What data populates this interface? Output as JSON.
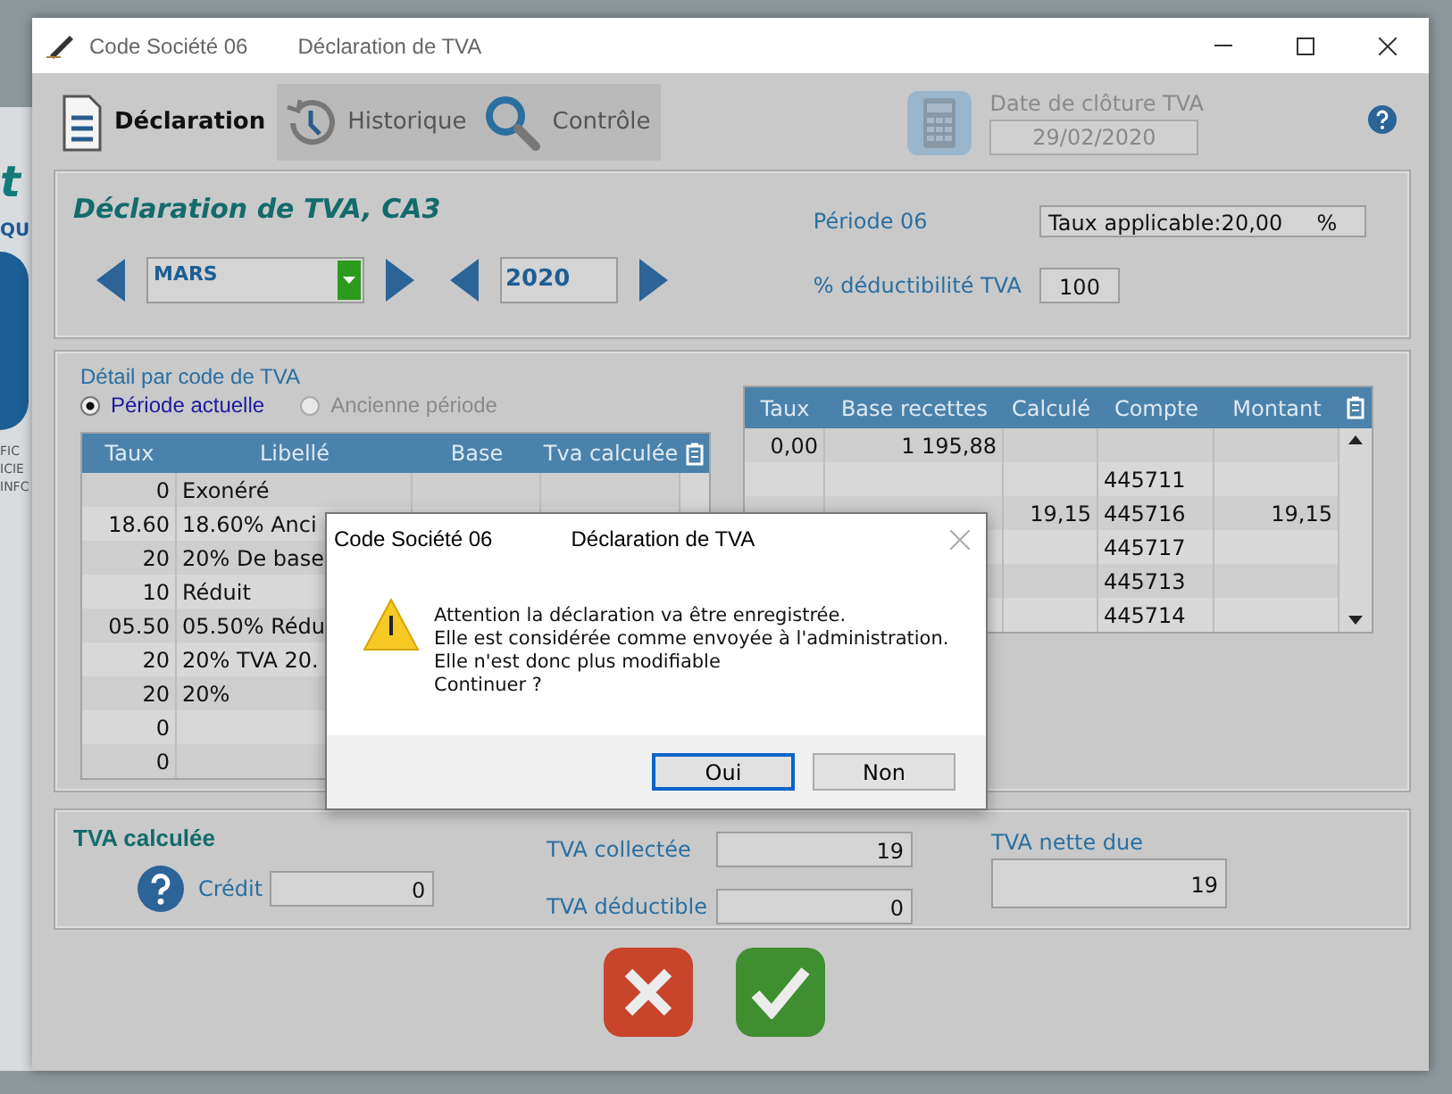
{
  "background": {
    "fragments": [
      {
        "text": "t",
        "kind": "heading"
      },
      {
        "text": "QU",
        "kind": "small"
      },
      {
        "text": "FIC",
        "kind": "tiny"
      },
      {
        "text": "ICIE",
        "kind": "tiny"
      },
      {
        "text": "INFC",
        "kind": "tiny"
      }
    ]
  },
  "window": {
    "title_parts": [
      "Code Société 06",
      "Déclaration de TVA"
    ]
  },
  "tabs": [
    {
      "label": "Déclaration",
      "selected": true
    },
    {
      "label": "Historique",
      "selected": false
    },
    {
      "label": "Contrôle",
      "selected": false
    }
  ],
  "closing_date": {
    "label": "Date de clôture TVA",
    "value": "29/02/2020"
  },
  "declaration": {
    "title": "Déclaration de TVA, CA3",
    "month": "MARS",
    "year": "2020",
    "period": "Période 06",
    "rate_field": "Taux applicable:20,00     %",
    "deductibility_label": "% déductibilité TVA",
    "deductibility": "100"
  },
  "detail": {
    "title": "Détail par code de TVA",
    "periods": [
      {
        "label": "Période actuelle",
        "selected": true,
        "disabled": false
      },
      {
        "label": "Ancienne période",
        "selected": false,
        "disabled": true
      }
    ]
  },
  "codes_table": {
    "columns": [
      "Taux",
      "Libellé",
      "Base",
      "Tva calculée"
    ],
    "rows": [
      {
        "taux": "0",
        "libelle": "Exonéré"
      },
      {
        "taux": "18.60",
        "libelle": "18.60% Anci"
      },
      {
        "taux": "20",
        "libelle": "20% De base"
      },
      {
        "taux": "10",
        "libelle": "Réduit"
      },
      {
        "taux": "05.50",
        "libelle": "05.50% Rédu"
      },
      {
        "taux": "20",
        "libelle": "20% TVA 20."
      },
      {
        "taux": "20",
        "libelle": "20%"
      },
      {
        "taux": "0"
      },
      {
        "taux": "0"
      }
    ]
  },
  "accounts_table": {
    "columns": [
      "Taux",
      "Base recettes",
      "Calculé",
      "Compte",
      "Montant"
    ],
    "rows": [
      {
        "taux": "0,00",
        "base": "1 195,88"
      },
      {
        "compte": "445711"
      },
      {
        "calcule": "19,15",
        "compte": "445716",
        "montant": "19,15"
      },
      {
        "compte": "445717"
      },
      {
        "compte": "445713"
      },
      {
        "compte": "445714"
      }
    ]
  },
  "totals": {
    "title": "TVA calculée",
    "credit_label": "Crédit",
    "credit": "0",
    "collected_label": "TVA collectée",
    "collected": "19",
    "deductible_label": "TVA déductible",
    "deductible": "0",
    "net_label": "TVA nette due",
    "net": "19"
  },
  "dialog": {
    "title_parts": [
      "Code Société 06",
      "Déclaration de TVA"
    ],
    "lines": [
      "Attention la déclaration va être enregistrée.",
      "Elle est considérée comme envoyée à l'administration.",
      "Elle n'est donc plus modifiable",
      "Continuer ?"
    ],
    "buttons": [
      {
        "label": "Oui",
        "selected": true
      },
      {
        "label": "Non",
        "selected": false
      }
    ]
  }
}
